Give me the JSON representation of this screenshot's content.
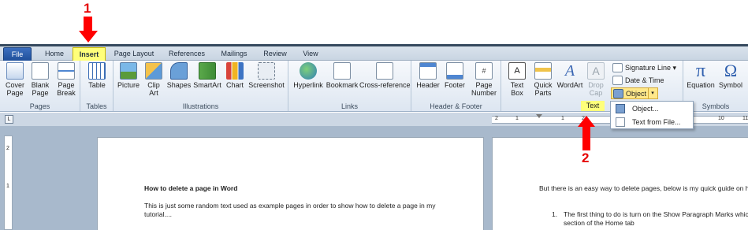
{
  "annotations": {
    "step1": "1",
    "step2": "2"
  },
  "tabs": [
    {
      "label": "File"
    },
    {
      "label": "Home"
    },
    {
      "label": "Insert"
    },
    {
      "label": "Page Layout"
    },
    {
      "label": "References"
    },
    {
      "label": "Mailings"
    },
    {
      "label": "Review"
    },
    {
      "label": "View"
    }
  ],
  "ribbon": {
    "pages": {
      "label": "Pages",
      "cover_page": "Cover Page",
      "blank_page": "Blank Page",
      "page_break": "Page Break"
    },
    "tables": {
      "label": "Tables",
      "table": "Table"
    },
    "illustrations": {
      "label": "Illustrations",
      "picture": "Picture",
      "clip_art": "Clip Art",
      "shapes": "Shapes",
      "smartart": "SmartArt",
      "chart": "Chart",
      "screenshot": "Screenshot"
    },
    "links": {
      "label": "Links",
      "hyperlink": "Hyperlink",
      "bookmark": "Bookmark",
      "cross_reference": "Cross-reference"
    },
    "header_footer": {
      "label": "Header & Footer",
      "header": "Header",
      "footer": "Footer",
      "page_number": "Page Number"
    },
    "text": {
      "label": "Text",
      "text_box": "Text Box",
      "quick_parts": "Quick Parts",
      "wordart": "WordArt",
      "drop_cap": "Drop Cap",
      "signature_line": "Signature Line",
      "date_time": "Date & Time",
      "object": "Object"
    },
    "symbols": {
      "label": "Symbols",
      "equation": "Equation",
      "symbol": "Symbol"
    }
  },
  "object_dropdown": {
    "item1": "Object...",
    "item2": "Text from File..."
  },
  "ruler": {
    "marks": [
      "2",
      "1",
      "1",
      "2",
      "8",
      "9",
      "10",
      "11"
    ]
  },
  "left_ruler": {
    "marks": [
      "2",
      "1"
    ]
  },
  "page1": {
    "heading": "How to delete a page in Word",
    "body": "This is just some random text used as example pages in order to show how to delete a page in my tutorial...."
  },
  "page2": {
    "intro": "But there is an easy way to delete pages, below is my quick guide on how",
    "list_number": "1.",
    "list_line1": "The first thing to do is turn on the Show Paragraph Marks which",
    "list_line2": "section of the Home tab"
  },
  "colors": {
    "accent_highlight": "#ffff7a",
    "annotation_red": "#e60000"
  }
}
